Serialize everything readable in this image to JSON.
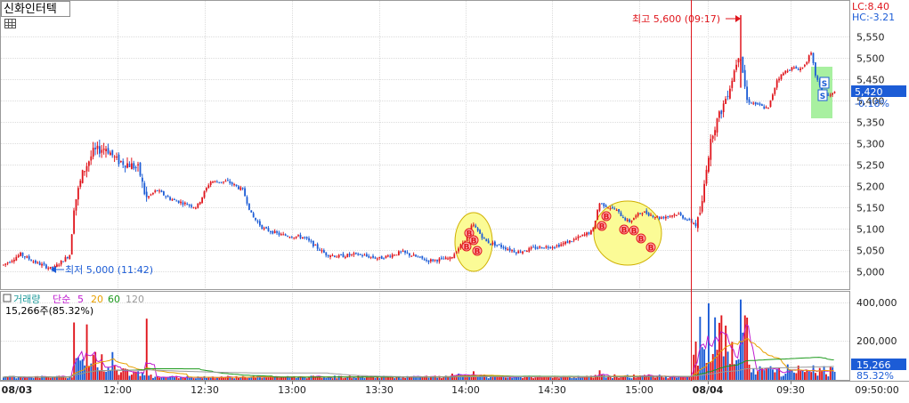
{
  "stock_name": "신화인터텍",
  "icons": {
    "grid": "table-grid-icon",
    "high_marker": "arrow-right-icon",
    "low_marker": "arrow-left-icon",
    "buy_signal": "B-signal-icon",
    "sell_signal": "S-signal-icon"
  },
  "colors": {
    "up": "#e0161d",
    "down": "#1c5cd6",
    "grid": "#dcdcdc",
    "ma5": "#c01cd0",
    "ma20": "#e8a000",
    "ma60": "#1c9a1c",
    "ma120": "#9a9a9a",
    "highlight_yellow": "#fbfb96",
    "highlight_green": "#a8f0a0",
    "current_price_bg": "#1c5cd6"
  },
  "price_axis": {
    "ticks": [
      "5,550",
      "5,500",
      "5,450",
      "5,400",
      "5,350",
      "5,300",
      "5,250",
      "5,200",
      "5,150",
      "5,100",
      "5,050",
      "5,000"
    ]
  },
  "indicators": {
    "lc": "LC:8.40",
    "hc": "HC:-3.21"
  },
  "current": {
    "price": "5,420",
    "change": "-0.18%"
  },
  "annotations": {
    "high": "최고 5,600 (09:17)",
    "low": "최저 5,000 (11:42)"
  },
  "volume_panel": {
    "legend": {
      "volume": "거래량",
      "ma_label": "단순",
      "p5": "5",
      "p20": "20",
      "p60": "60",
      "p120": "120"
    },
    "info": "15,266주(85.32%)",
    "ticks": [
      "400,000",
      "200,000"
    ],
    "current_volume": "15,266",
    "current_pct": "85.32%"
  },
  "time_axis": {
    "labels": [
      "08/03",
      "12:00",
      "12:30",
      "13:00",
      "13:30",
      "14:00",
      "14:30",
      "15:00",
      "08/04",
      "09:30",
      "09:50:00"
    ]
  },
  "chart_data": {
    "type": "candlestick",
    "y_range": [
      4980,
      5600
    ],
    "price_series": [
      {
        "t": "08/03 11:05",
        "v": 5015
      },
      {
        "t": "11:20",
        "v": 5040
      },
      {
        "t": "11:35",
        "v": 5020
      },
      {
        "t": "11:42",
        "v": 5005
      },
      {
        "t": "11:50",
        "v": 5040
      },
      {
        "t": "11:52",
        "v": 5150
      },
      {
        "t": "11:58",
        "v": 5260
      },
      {
        "t": "12:00",
        "v": 5300
      },
      {
        "t": "12:05",
        "v": 5260
      },
      {
        "t": "12:10",
        "v": 5250
      },
      {
        "t": "12:15",
        "v": 5270
      },
      {
        "t": "12:20",
        "v": 5160
      },
      {
        "t": "12:25",
        "v": 5180
      },
      {
        "t": "12:35",
        "v": 5210
      },
      {
        "t": "12:45",
        "v": 5210
      },
      {
        "t": "12:52",
        "v": 5120
      },
      {
        "t": "13:00",
        "v": 5090
      },
      {
        "t": "13:10",
        "v": 5080
      },
      {
        "t": "13:20",
        "v": 5050
      },
      {
        "t": "13:30",
        "v": 5040
      },
      {
        "t": "13:40",
        "v": 5035
      },
      {
        "t": "13:50",
        "v": 5030
      },
      {
        "t": "14:00",
        "v": 5030
      },
      {
        "t": "14:05",
        "v": 5110
      },
      {
        "t": "14:15",
        "v": 5060
      },
      {
        "t": "14:25",
        "v": 5050
      },
      {
        "t": "14:35",
        "v": 5070
      },
      {
        "t": "14:45",
        "v": 5100
      },
      {
        "t": "14:50",
        "v": 5170
      },
      {
        "t": "15:00",
        "v": 5130
      },
      {
        "t": "15:10",
        "v": 5120
      },
      {
        "t": "15:15",
        "v": 5105
      },
      {
        "t": "08/04 09:02",
        "v": 5140
      },
      {
        "t": "09:07",
        "v": 5330
      },
      {
        "t": "09:12",
        "v": 5420
      },
      {
        "t": "09:17",
        "v": 5560
      },
      {
        "t": "09:22",
        "v": 5420
      },
      {
        "t": "09:30",
        "v": 5460
      },
      {
        "t": "09:40",
        "v": 5480
      },
      {
        "t": "09:45",
        "v": 5430
      },
      {
        "t": "09:50",
        "v": 5420
      }
    ],
    "volume_series": [
      {
        "t": "11:52",
        "v": 300000
      },
      {
        "t": "12:00",
        "v": 150000
      },
      {
        "t": "12:20",
        "v": 200000
      },
      {
        "t": "14:05",
        "v": 40000
      },
      {
        "t": "14:50",
        "v": 40000
      },
      {
        "t": "09:05",
        "v": 400000
      },
      {
        "t": "09:17",
        "v": 420000
      },
      {
        "t": "09:30",
        "v": 100000
      },
      {
        "t": "09:50",
        "v": 15266
      }
    ],
    "high": {
      "value": 5600,
      "time": "09:17"
    },
    "low": {
      "value": 5000,
      "time": "11:42"
    },
    "last": 5420
  }
}
